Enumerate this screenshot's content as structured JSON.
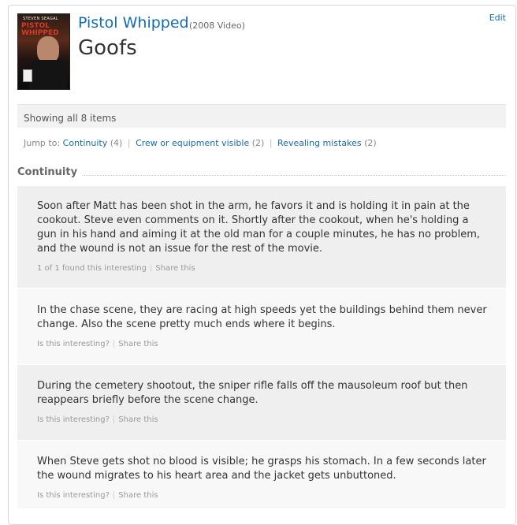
{
  "header": {
    "title": "Pistol Whipped",
    "year": "(2008 Video)",
    "heading": "Goofs",
    "edit": "Edit",
    "poster": {
      "credit": "STEVEN SEAGAL",
      "title": "PISTOL WHIPPED"
    }
  },
  "summary": {
    "showing": "Showing all 8 items"
  },
  "jump": {
    "label": "Jump to:",
    "links": [
      {
        "label": "Continuity",
        "count": "(4)"
      },
      {
        "label": "Crew or equipment visible",
        "count": "(2)"
      },
      {
        "label": "Revealing mistakes",
        "count": "(2)"
      }
    ]
  },
  "section": {
    "title": "Continuity"
  },
  "items": [
    {
      "text": "Soon after Matt has been shot in the arm, he favors it and is holding it in pain at the cookout. Steve even comments on it. Shortly after the cookout, when he's holding a gun in his hand and aiming it at the old man for a couple minutes, he has no problem, and the wound is not an issue for the rest of the movie.",
      "interest": "1 of 1 found this interesting",
      "share": "Share this"
    },
    {
      "text": "In the chase scene, they are racing at high speeds yet the buildings behind them never change. Also the scene pretty much ends where it begins.",
      "interest": "Is this interesting?",
      "share": "Share this"
    },
    {
      "text": "During the cemetery shootout, the sniper rifle falls off the mausoleum roof but then reappears briefly before the scene change.",
      "interest": "Is this interesting?",
      "share": "Share this"
    },
    {
      "text": "When Steve gets shot no blood is visible; he grasps his stomach. In a few seconds later the wound migrates to his heart area and the jacket gets unbuttoned.",
      "interest": "Is this interesting?",
      "share": "Share this"
    }
  ]
}
